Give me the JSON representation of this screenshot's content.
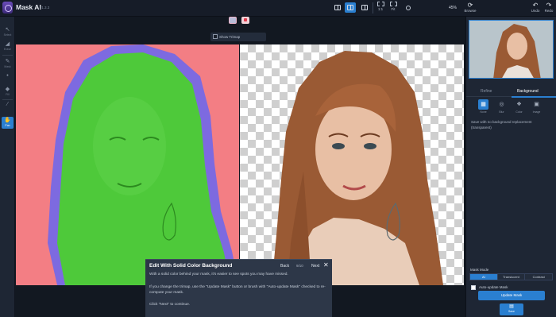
{
  "app": {
    "title": "Mask AI",
    "version": "v1.3.3"
  },
  "topbar": {
    "fit_labels": [
      "1:1",
      "Fit"
    ],
    "zoom": "45%",
    "browse_label": "Browse",
    "undo_label": "Undo",
    "redo_label": "Redo"
  },
  "left_tools": [
    {
      "icon": "select-icon",
      "label": "Select"
    },
    {
      "icon": "eraser-icon",
      "label": "Erase"
    },
    {
      "icon": "brush-icon",
      "label": "Mask"
    },
    {
      "icon": "dot-icon",
      "label": ""
    },
    {
      "icon": "fill-icon",
      "label": "Fill"
    },
    {
      "icon": "picker-icon",
      "label": ""
    },
    {
      "icon": "pan-icon",
      "label": "Pan"
    }
  ],
  "viewbar": {
    "show_trimap_label": "Show Trimap"
  },
  "right_panel": {
    "tabs": [
      "Refine",
      "Background"
    ],
    "active_tab": "Background",
    "bg_options": [
      "None",
      "Blur",
      "Color",
      "Image"
    ],
    "description": "Save with no background replacement (transparent)",
    "mask_mode_label": "Mask Mode",
    "mask_modes": [
      "AI",
      "Translucent",
      "Contrast"
    ],
    "active_mode": "AI",
    "auto_update_label": "Auto-update Mask",
    "update_button": "Update Mask",
    "save_button": "Save"
  },
  "popup": {
    "title": "Edit With Solid Color Background",
    "back": "Back",
    "counter": "9/10",
    "next": "Next",
    "p1": "With a solid color behind your mask, it's easier to see spots you may have missed.",
    "p2": "If you change the trimap, use the \"Update Mask\" button or brush with \"Auto-update Mask\" checked to re-compute your mask.",
    "p3": "Click \"Next\" to continue."
  },
  "colors": {
    "accent": "#2a7fd0",
    "mask_bg": "#f37e84",
    "mask_fg": "#4ec93a",
    "trimap": "#7d6ae0"
  }
}
